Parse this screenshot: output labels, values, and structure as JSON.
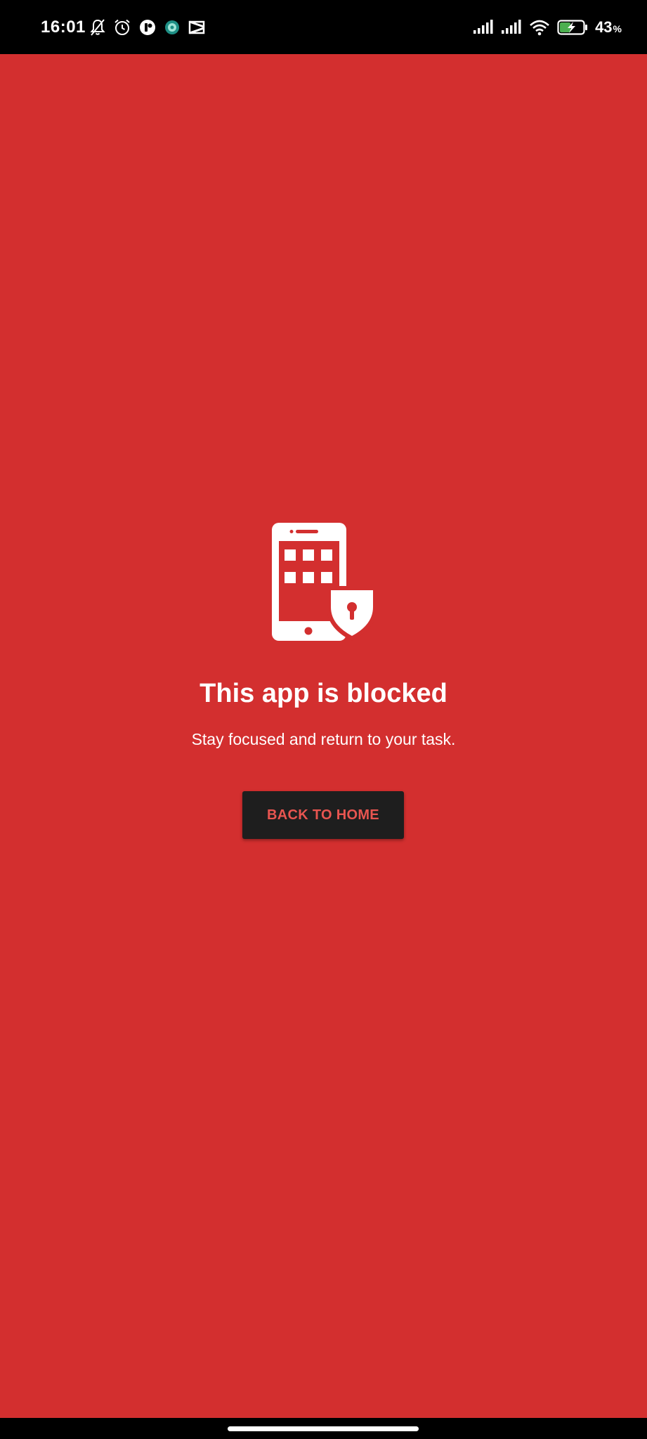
{
  "status_bar": {
    "time": "16:01",
    "left_icons": [
      "bell-off-icon",
      "alarm-icon",
      "app-notification-icon",
      "app-badge-icon",
      "capcut-icon"
    ],
    "right_icons": [
      "signal-icon",
      "signal-icon",
      "wifi-icon",
      "battery-charging-icon"
    ],
    "battery_percent": "43",
    "battery_unit": "%"
  },
  "blocked": {
    "icon": "phone-lock-shield-icon",
    "title": "This app is blocked",
    "subtitle": "Stay focused and return to your task.",
    "button_label": "BACK TO HOME"
  },
  "colors": {
    "background": "#d32f2f",
    "button_bg": "#1e1e1e",
    "button_text": "#e85550",
    "text": "#ffffff"
  }
}
